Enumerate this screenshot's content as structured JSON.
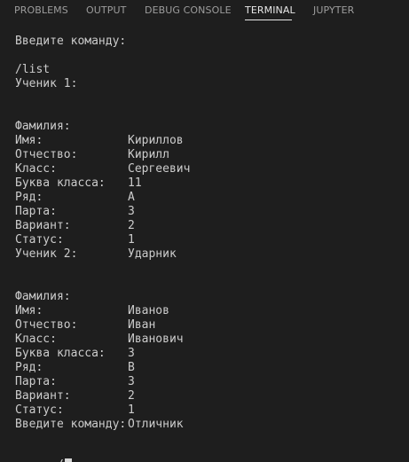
{
  "tabs": {
    "problems": "PROBLEMS",
    "output": "OUTPUT",
    "debug_console": "DEBUG CONSOLE",
    "terminal": "TERMINAL",
    "jupyter": "JUPYTER",
    "active": "TERMINAL"
  },
  "terminal": {
    "prompt1": "Введите команду:",
    "command1": "/list",
    "student1": {
      "header": "Ученик 1:",
      "rows": [
        {
          "label": "Фамилия:",
          "value": "Кириллов"
        },
        {
          "label": "Имя:",
          "value": "Кирилл"
        },
        {
          "label": "Отчество:",
          "value": "Сергеевич"
        },
        {
          "label": "Класс:",
          "value": "11"
        },
        {
          "label": "Буква класса:",
          "value": "А"
        },
        {
          "label": "Ряд:",
          "value": "3"
        },
        {
          "label": "Парта:",
          "value": "2"
        },
        {
          "label": "Вариант:",
          "value": "1"
        },
        {
          "label": "Статус:",
          "value": "Ударник"
        }
      ]
    },
    "student2": {
      "header": "Ученик 2:",
      "rows": [
        {
          "label": "Фамилия:",
          "value": "Иванов"
        },
        {
          "label": "Имя:",
          "value": "Иван"
        },
        {
          "label": "Отчество:",
          "value": "Иванович"
        },
        {
          "label": "Класс:",
          "value": "3"
        },
        {
          "label": "Буква класса:",
          "value": "В"
        },
        {
          "label": "Ряд:",
          "value": "3"
        },
        {
          "label": "Парта:",
          "value": "2"
        },
        {
          "label": "Вариант:",
          "value": "1"
        },
        {
          "label": "Статус:",
          "value": "Отличник"
        }
      ]
    },
    "prompt2": "Введите команду:",
    "input": "/"
  },
  "colors": {
    "background": "#1e1e1e",
    "text": "#cccccc",
    "tab_inactive": "#9d9d9d",
    "tab_active": "#e7e7e7"
  }
}
